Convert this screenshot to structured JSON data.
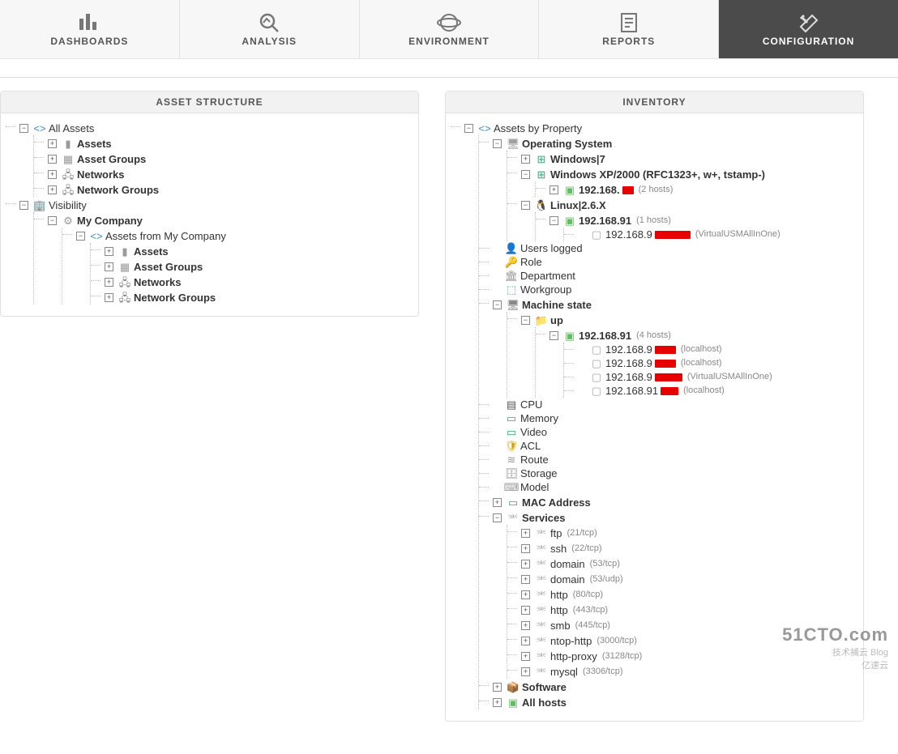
{
  "nav": {
    "dashboards": "DASHBOARDS",
    "analysis": "ANALYSIS",
    "environment": "ENVIRONMENT",
    "reports": "REPORTS",
    "configuration": "CONFIGURATION"
  },
  "panels": {
    "asset_structure": "ASSET STRUCTURE",
    "inventory": "INVENTORY"
  },
  "asset_tree": {
    "all_assets": "All Assets",
    "assets": "Assets",
    "asset_groups": "Asset Groups",
    "networks": "Networks",
    "network_groups": "Network Groups",
    "visibility": "Visibility",
    "my_company": "My Company",
    "assets_from_company": "Assets from My Company"
  },
  "inv": {
    "root": "Assets by Property",
    "os": "Operating System",
    "win7": "Windows|7",
    "winxp": "Windows XP/2000 (RFC1323+, w+, tstamp-)",
    "winxp_ip": "192.168.",
    "winxp_count": "(2 hosts)",
    "linux": "Linux|2.6.X",
    "linux_net": "192.168.91",
    "linux_net_count": "(1 hosts)",
    "linux_ip": "192.168.9",
    "linux_ip_note": "(VirtualUSMAllInOne)",
    "users_logged": "Users logged",
    "role": "Role",
    "department": "Department",
    "workgroup": "Workgroup",
    "machine_state": "Machine state",
    "up": "up",
    "up_net": "192.168.91",
    "up_net_count": "(4 hosts)",
    "h1_ip": "192.168.9",
    "h1_note": "(localhost)",
    "h2_ip": "192.168.9",
    "h2_note": "(localhost)",
    "h3_ip": "192.168.9",
    "h3_note": "(VirtualUSMAllInOne)",
    "h4_ip": "192.168.91",
    "h4_note": "(localhost)",
    "cpu": "CPU",
    "memory": "Memory",
    "video": "Video",
    "acl": "ACL",
    "route": "Route",
    "storage": "Storage",
    "model": "Model",
    "mac": "MAC Address",
    "services": "Services",
    "svc": [
      {
        "n": "ftp",
        "p": "(21/tcp)"
      },
      {
        "n": "ssh",
        "p": "(22/tcp)"
      },
      {
        "n": "domain",
        "p": "(53/tcp)"
      },
      {
        "n": "domain",
        "p": "(53/udp)"
      },
      {
        "n": "http",
        "p": "(80/tcp)"
      },
      {
        "n": "http",
        "p": "(443/tcp)"
      },
      {
        "n": "smb",
        "p": "(445/tcp)"
      },
      {
        "n": "ntop-http",
        "p": "(3000/tcp)"
      },
      {
        "n": "http-proxy",
        "p": "(3128/tcp)"
      },
      {
        "n": "mysql",
        "p": "(3306/tcp)"
      }
    ],
    "software": "Software",
    "all_hosts": "All hosts"
  },
  "watermark": {
    "l1": "51CTO.com",
    "l2": "技术捕云  Blog",
    "l3": "亿速云"
  }
}
